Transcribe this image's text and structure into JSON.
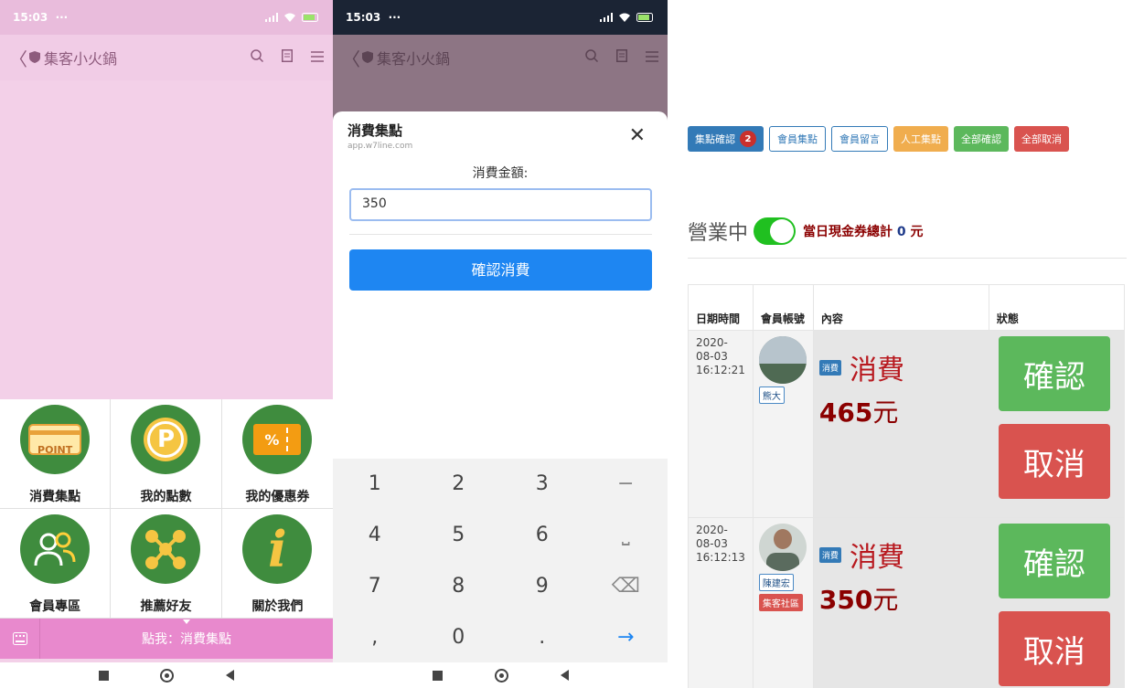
{
  "phone1": {
    "status": {
      "time": "15:03",
      "dots": "···"
    },
    "app": {
      "back": "〈",
      "title": "集客小火鍋"
    },
    "menu": [
      {
        "label": "消費集點",
        "icon": "point-card-icon",
        "badge": "POINT"
      },
      {
        "label": "我的點數",
        "icon": "p-coin-icon",
        "badge": "P"
      },
      {
        "label": "我的優惠券",
        "icon": "coupon-icon",
        "badge": "%"
      },
      {
        "label": "會員專區",
        "icon": "members-icon"
      },
      {
        "label": "推薦好友",
        "icon": "share-network-icon"
      },
      {
        "label": "關於我們",
        "icon": "info-icon",
        "badge": "i"
      }
    ],
    "bottom_text": "點我：消費集點"
  },
  "phone2": {
    "status": {
      "time": "15:03",
      "dots": "···"
    },
    "app": {
      "back": "〈",
      "title": "集客小火鍋"
    },
    "dialog": {
      "title": "消費集點",
      "subtitle": "app.w7line.com",
      "close": "✕",
      "amount_label": "消費金額:",
      "amount_value": "350",
      "confirm": "確認消費"
    },
    "keys": [
      "1",
      "2",
      "3",
      "−",
      "4",
      "5",
      "6",
      "⎵",
      "7",
      "8",
      "9",
      "⌫",
      ",",
      "0",
      ".",
      "→"
    ]
  },
  "admin": {
    "buttons": {
      "confirm_points": "集點確認",
      "confirm_count": "2",
      "member_points": "會員集點",
      "member_messages": "會員留言",
      "manual_points": "人工集點",
      "confirm_all": "全部確認",
      "cancel_all": "全部取消"
    },
    "status_label": "營業中",
    "summary_prefix": "當日現金券總計",
    "summary_value": "0",
    "summary_unit": "元",
    "table": {
      "headers": [
        "日期時間",
        "會員帳號",
        "內容",
        "狀態"
      ],
      "rows": [
        {
          "date": "2020-",
          "date2": "08-03",
          "time": "16:12:21",
          "member": "熊大",
          "member_tag2": "",
          "chip": "消費",
          "kind": "消費",
          "amount": "465",
          "unit": "元",
          "confirm": "確認",
          "cancel": "取消"
        },
        {
          "date": "2020-",
          "date2": "08-03",
          "time": "16:12:13",
          "member": "陳建宏",
          "member_tag2": "集客社區",
          "chip": "消費",
          "kind": "消費",
          "amount": "350",
          "unit": "元",
          "confirm": "確認",
          "cancel": "取消"
        }
      ]
    }
  },
  "colors": {
    "pink_bg": "#f3d0e8",
    "pink_bar": "#e889cd",
    "green_icon": "#3f8c3e",
    "primary_blue": "#1e86f2",
    "danger": "#d9534f",
    "success": "#5cb85c"
  }
}
